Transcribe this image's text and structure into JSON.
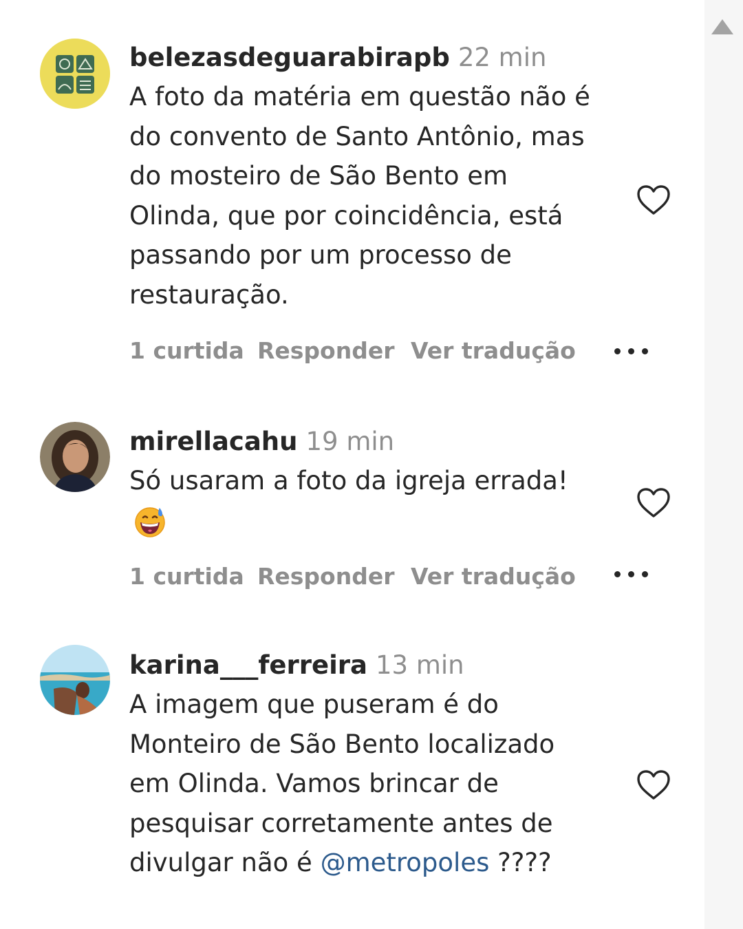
{
  "comments": [
    {
      "username": "belezasdeguarabirapb",
      "time": "22 min",
      "lines": [
        "A foto da matéria em questão não é",
        "do convento de Santo Antônio, mas",
        "do mosteiro de São Bento em",
        "Olinda, que por coincidência, está",
        "passando por um processo de",
        "restauração."
      ],
      "likes": "1 curtida",
      "reply_label": "Responder",
      "translate_label": "Ver tradução",
      "avatar_color": "#ecdc5a"
    },
    {
      "username": "mirellacahu",
      "time": "19 min",
      "lines": [
        "Só usaram a foto da igreja errada!"
      ],
      "emoji": "grinning-sweat-emoji",
      "likes": "1 curtida",
      "reply_label": "Responder",
      "translate_label": "Ver tradução"
    },
    {
      "username": "karina___ferreira",
      "time": "13 min",
      "lines": [
        "A imagem que puseram é do",
        "Monteiro de São Bento localizado",
        "em Olinda. Vamos brincar de",
        "pesquisar corretamente antes de"
      ],
      "last_line_prefix": "divulgar não é ",
      "mention": "@metropoles",
      "last_line_suffix": " ????"
    }
  ],
  "colors": {
    "text": "#262626",
    "muted": "#8e8e8e",
    "mention": "#2c5a8c",
    "scrollbar": "#f6f6f6"
  }
}
